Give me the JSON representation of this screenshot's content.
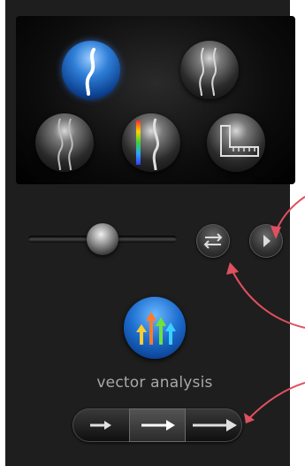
{
  "view_modes": [
    {
      "icon": "vessel-blue-icon",
      "active": true
    },
    {
      "icon": "vessel-outline-icon",
      "active": false
    },
    {
      "icon": "vessel-grey-icon",
      "active": false
    },
    {
      "icon": "vessel-colorscale-icon",
      "active": false
    },
    {
      "icon": "measure-ruler-icon",
      "active": false
    }
  ],
  "slider": {
    "value": 0.5
  },
  "buttons": {
    "swap_icon": "swap-arrows-icon",
    "next_icon": "chevron-right-icon"
  },
  "vector": {
    "label": "vector analysis",
    "icon": "vector-arrows-icon"
  },
  "arrow_sizes": {
    "options": [
      "small",
      "medium",
      "large"
    ],
    "selected": "medium"
  },
  "colors": {
    "accent_blue": "#1e6fd0",
    "callout_red": "#e05060",
    "panel": "#1e1e1e"
  }
}
